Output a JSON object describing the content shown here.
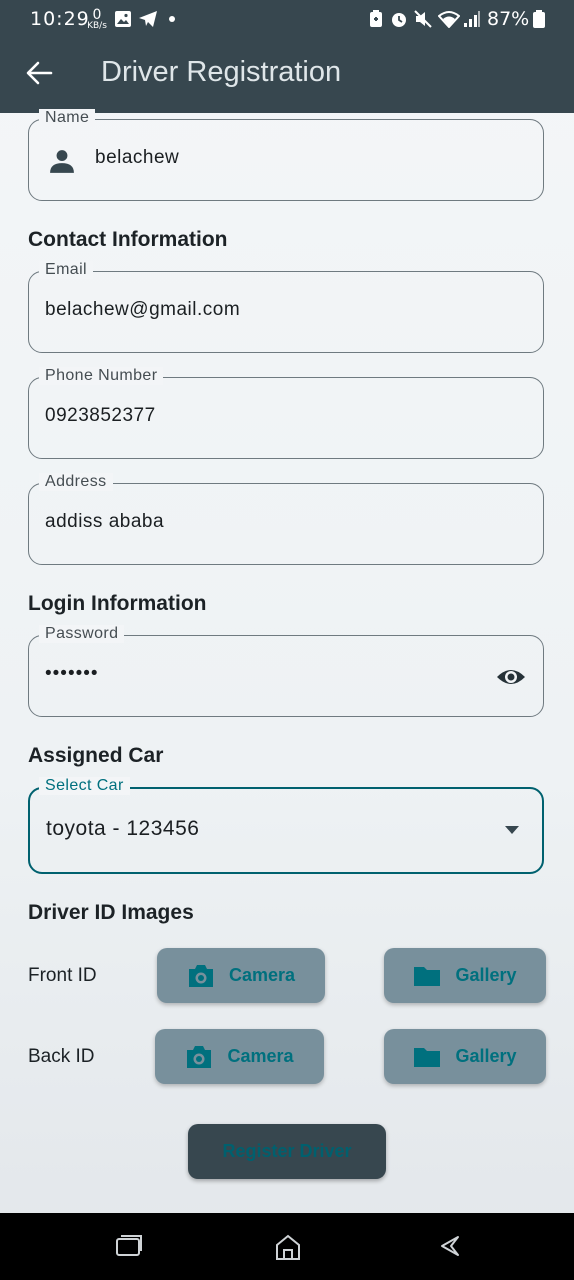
{
  "status_bar": {
    "time": "10:29",
    "net_speed_value": "0",
    "net_speed_unit": "KB/s",
    "battery": "87%",
    "icons": [
      "image-icon",
      "telegram-icon",
      "dot-icon",
      "battery-saver-icon",
      "alarm-icon",
      "mute-icon",
      "wifi-icon",
      "signal-icon",
      "battery-icon"
    ]
  },
  "app_bar": {
    "title": "Driver Registration",
    "back_icon": "arrow-left-icon"
  },
  "form": {
    "name": {
      "label": "Name",
      "value": "belachew",
      "icon": "person-icon"
    },
    "contact_heading": "Contact Information",
    "email": {
      "label": "Email",
      "value": "belachew@gmail.com"
    },
    "phone": {
      "label": "Phone Number",
      "value": "0923852377"
    },
    "address": {
      "label": "Address",
      "value": "addiss ababa"
    },
    "login_heading": "Login Information",
    "password": {
      "label": "Password",
      "value": "•••••••",
      "icon": "eye-icon"
    },
    "car_heading": "Assigned Car",
    "car": {
      "label": "Select Car",
      "value": "toyota - 123456",
      "icon": "dropdown-arrow-icon"
    },
    "images_heading": "Driver ID Images",
    "front": {
      "label": "Front ID",
      "camera": "Camera",
      "gallery": "Gallery"
    },
    "back": {
      "label": "Back ID",
      "camera": "Camera",
      "gallery": "Gallery"
    },
    "submit": "Register Driver"
  },
  "colors": {
    "app_bar": "#37474f",
    "accent": "#00707e",
    "button": "#78909c"
  },
  "nav_bar": {
    "icons": [
      "recent-apps-icon",
      "home-icon",
      "back-icon"
    ]
  }
}
